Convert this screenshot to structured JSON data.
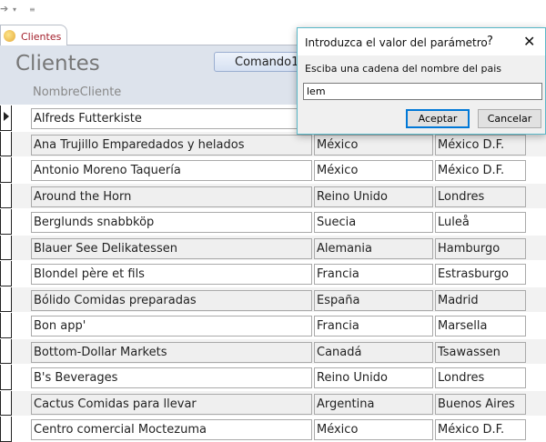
{
  "quick_access": {
    "redo": "➔",
    "dropdown": "▾",
    "customize": "≡"
  },
  "tab": {
    "label": "Clientes"
  },
  "form": {
    "title": "Clientes",
    "command_button": "Comando11",
    "column_header": "NombreCliente"
  },
  "rows": [
    {
      "name": "Alfreds Futterkiste",
      "country": "",
      "city": ""
    },
    {
      "name": "Ana Trujillo Emparedados y helados",
      "country": "México",
      "city": "México D.F."
    },
    {
      "name": "Antonio Moreno Taquería",
      "country": "México",
      "city": "México D.F."
    },
    {
      "name": "Around the Horn",
      "country": "Reino Unido",
      "city": "Londres"
    },
    {
      "name": "Berglunds snabbköp",
      "country": "Suecia",
      "city": "Luleå"
    },
    {
      "name": "Blauer See Delikatessen",
      "country": "Alemania",
      "city": "Hamburgo"
    },
    {
      "name": "Blondel père et fils",
      "country": "Francia",
      "city": "Estrasburgo"
    },
    {
      "name": "Bólido Comidas preparadas",
      "country": "España",
      "city": "Madrid"
    },
    {
      "name": "Bon app'",
      "country": "Francia",
      "city": "Marsella"
    },
    {
      "name": "Bottom-Dollar Markets",
      "country": "Canadá",
      "city": "Tsawassen"
    },
    {
      "name": "B's Beverages",
      "country": "Reino Unido",
      "city": "Londres"
    },
    {
      "name": "Cactus Comidas para llevar",
      "country": "Argentina",
      "city": "Buenos Aires"
    },
    {
      "name": "Centro comercial Moctezuma",
      "country": "México",
      "city": "México D.F."
    }
  ],
  "dialog": {
    "title": "Introduzca el valor del parámetro",
    "help": "?",
    "close": "✕",
    "prompt": "Esciba una cadena del nombre del pais",
    "value": "lem",
    "ok": "Aceptar",
    "cancel": "Cancelar"
  }
}
